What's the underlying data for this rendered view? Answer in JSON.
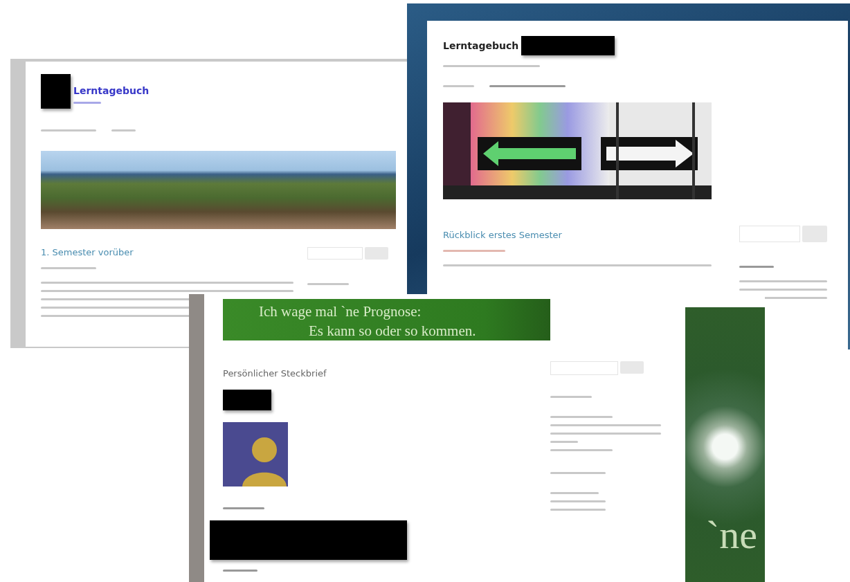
{
  "screenshot_left": {
    "site_title": "Lerntagebuch",
    "post_title": "1. Semester vorüber"
  },
  "screenshot_right": {
    "site_title": "Lerntagebuch",
    "post_title": "Rückblick erstes Semester"
  },
  "screenshot_front": {
    "banner_lines": [
      "Ich wage mal `ne Prognose:",
      "Es kann so oder so kommen."
    ],
    "post_title": "Persönlicher Steckbrief",
    "side_strip_text": "`ne"
  }
}
